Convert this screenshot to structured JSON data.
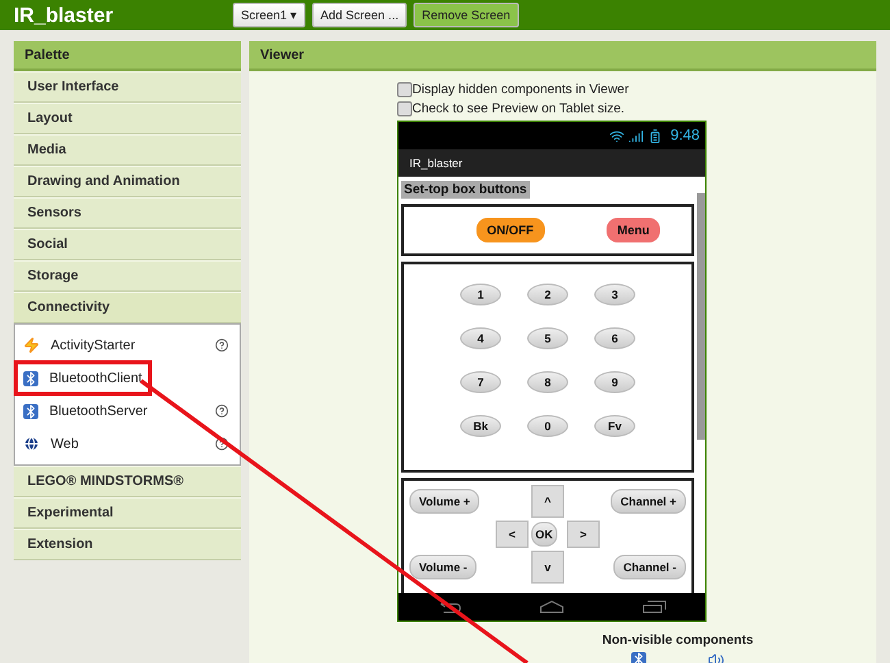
{
  "header": {
    "title": "IR_blaster",
    "buttons": [
      {
        "label": "Screen1 ▾",
        "kind": "dropdown"
      },
      {
        "label": "Add Screen ...",
        "kind": "plain"
      },
      {
        "label": "Remove Screen",
        "kind": "accent"
      }
    ]
  },
  "palette": {
    "title": "Palette",
    "categories": [
      {
        "label": "User Interface"
      },
      {
        "label": "Layout"
      },
      {
        "label": "Media"
      },
      {
        "label": "Drawing and Animation"
      },
      {
        "label": "Sensors"
      },
      {
        "label": "Social"
      },
      {
        "label": "Storage"
      },
      {
        "label": "Connectivity",
        "items": [
          {
            "label": "ActivityStarter",
            "kind": "bolt",
            "highlighted": false
          },
          {
            "label": "BluetoothClient",
            "kind": "bluetooth",
            "highlighted": true
          },
          {
            "label": "BluetoothServer",
            "kind": "bluetooth",
            "highlighted": false
          },
          {
            "label": "Web",
            "kind": "globe",
            "highlighted": false
          }
        ]
      },
      {
        "label": "LEGO® MINDSTORMS®"
      },
      {
        "label": "Experimental"
      },
      {
        "label": "Extension"
      }
    ]
  },
  "viewer": {
    "title": "Viewer",
    "options": [
      {
        "label": "Display hidden components in Viewer",
        "checked": false
      },
      {
        "label": "Check to see Preview on Tablet size.",
        "checked": false
      }
    ],
    "phone": {
      "time": "9:48",
      "app_title": "IR_blaster",
      "section_label": "Set-top box buttons",
      "top_buttons": [
        {
          "label": "ON/OFF",
          "color": "#f7941d"
        },
        {
          "label": "Menu",
          "color": "#f07070"
        }
      ],
      "keypad": [
        "1",
        "2",
        "3",
        "4",
        "5",
        "6",
        "7",
        "8",
        "9",
        "Bk",
        "0",
        "Fv"
      ],
      "controls": {
        "volume_up": "Volume +",
        "volume_down": "Volume -",
        "channel_up": "Channel +",
        "channel_down": "Channel -",
        "up": "^",
        "left": "<",
        "ok": "OK",
        "right": ">",
        "down": "v"
      }
    },
    "non_visible": {
      "title": "Non-visible components",
      "components": [
        {
          "kind": "bluetooth"
        },
        {
          "kind": "sound"
        }
      ]
    }
  }
}
